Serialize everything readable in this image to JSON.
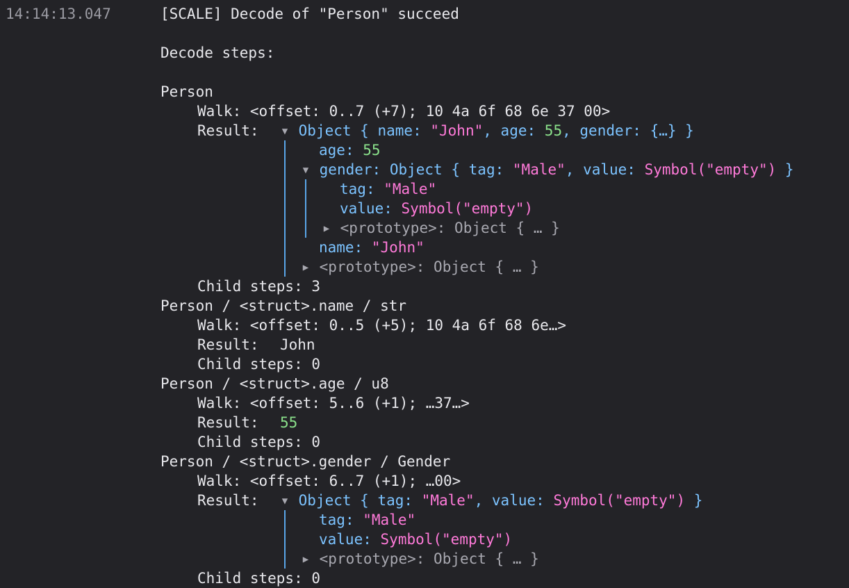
{
  "log": {
    "timestamp": "14:14:13.047",
    "message": "[SCALE] Decode of \"Person\" succeed",
    "decode_steps_label": "Decode steps:",
    "walk_label": "Walk:",
    "result_label": "Result:",
    "child_steps_label": "Child steps:",
    "object_label": "Object",
    "prototype_label": "<prototype>",
    "object_ellipsis": "Object { … }",
    "open_brace": "{",
    "close_brace": "}",
    "comma": ",",
    "colon": ":"
  },
  "steps": [
    {
      "path": "Person",
      "walk": "<offset: 0..7 (+7); 10 4a 6f 68 6e 37 00>",
      "child_steps": "3",
      "summary": {
        "name_key": "name",
        "name_value": "\"John\"",
        "age_key": "age",
        "age_value": "55",
        "gender_key": "gender",
        "gender_value": "{…}"
      },
      "fields": {
        "age_key": "age",
        "age_value": "55",
        "gender_key": "gender",
        "gender_summary": {
          "tag_key": "tag",
          "tag_value": "\"Male\"",
          "value_key": "value",
          "value_value": "Symbol(\"empty\")"
        },
        "gender_fields": {
          "tag_key": "tag",
          "tag_value": "\"Male\"",
          "value_key": "value",
          "value_value": "Symbol(\"empty\")"
        },
        "name_key": "name",
        "name_value": "\"John\""
      }
    },
    {
      "path": "Person / <struct>.name / str",
      "walk": "<offset: 0..5 (+5); 10 4a 6f 68 6e…>",
      "result": "John",
      "child_steps": "0"
    },
    {
      "path": "Person / <struct>.age / u8",
      "walk": "<offset: 5..6 (+1); …37…>",
      "result": "55",
      "child_steps": "0"
    },
    {
      "path": "Person / <struct>.gender / Gender",
      "walk": "<offset: 6..7 (+1); …00>",
      "child_steps": "0",
      "summary": {
        "tag_key": "tag",
        "tag_value": "\"Male\"",
        "value_key": "value",
        "value_value": "Symbol(\"empty\")"
      },
      "fields": {
        "tag_key": "tag",
        "tag_value": "\"Male\"",
        "value_key": "value",
        "value_value": "Symbol(\"empty\")"
      }
    }
  ],
  "colors": {
    "background": "#232327",
    "text": "#e8e8ec",
    "property": "#7cc3ff",
    "string": "#ff7ad9",
    "number": "#8be28b",
    "muted": "#a8a8b0",
    "guide_line": "#5aa7ea"
  },
  "icons": {
    "expanded": "triangle-down-icon",
    "collapsed": "triangle-right-icon"
  }
}
